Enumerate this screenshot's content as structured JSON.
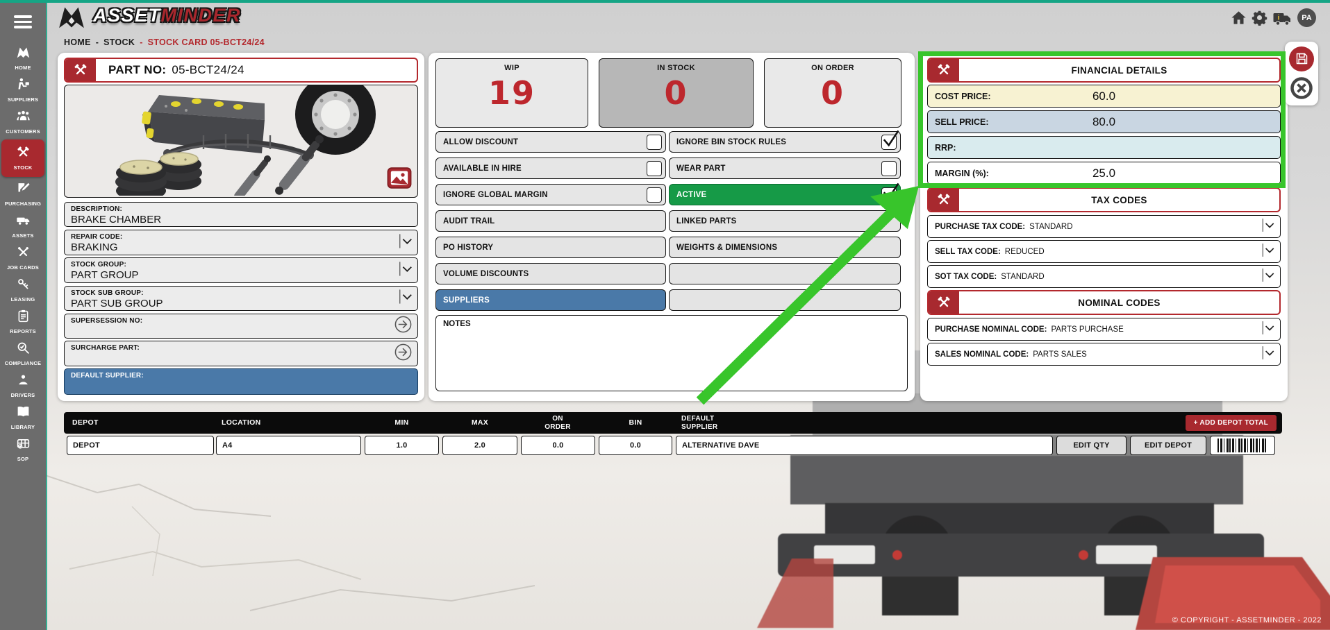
{
  "page": {
    "copyright": "© COPYRIGHT - ASSETMINDER - 2022"
  },
  "topbar": {
    "logo": {
      "mark_icon": "assetminder-mark",
      "asset": "ASSET",
      "minder": "MINDER"
    },
    "actions": {
      "home_icon": "home",
      "settings_icon": "gear",
      "fleet_icon": "truck-info",
      "avatar": "PA"
    }
  },
  "breadcrumb": {
    "home": "HOME",
    "sep1": "-",
    "stock": "STOCK",
    "sep2": "-",
    "current": "STOCK CARD 05-BCT24/24"
  },
  "sidebar": {
    "items": [
      {
        "label": "HOME",
        "icon": "brand-mark"
      },
      {
        "label": "SUPPLIERS",
        "icon": "supplier-person"
      },
      {
        "label": "CUSTOMERS",
        "icon": "people-group"
      },
      {
        "label": "STOCK",
        "icon": "crossed-pistons",
        "active": true
      },
      {
        "label": "PURCHASING",
        "icon": "document-pen"
      },
      {
        "label": "ASSETS",
        "icon": "truck"
      },
      {
        "label": "JOB CARDS",
        "icon": "crossed-tools"
      },
      {
        "label": "LEASING",
        "icon": "keys"
      },
      {
        "label": "REPORTS",
        "icon": "clipboard"
      },
      {
        "label": "COMPLIANCE",
        "icon": "magnifier-check"
      },
      {
        "label": "DRIVERS",
        "icon": "driver"
      },
      {
        "label": "LIBRARY",
        "icon": "open-book"
      },
      {
        "label": "SOP",
        "icon": "van-check"
      }
    ]
  },
  "part_card": {
    "header": {
      "label": "PART NO:",
      "value": "05-BCT24/24",
      "icon": "crossed-pistons"
    },
    "image_icon": "picture",
    "fields": [
      {
        "label": "DESCRIPTION:",
        "value": "BRAKE CHAMBER",
        "control": "none"
      },
      {
        "label": "REPAIR CODE:",
        "value": "BRAKING",
        "control": "dropdown"
      },
      {
        "label": "STOCK GROUP:",
        "value": "PART GROUP",
        "control": "dropdown"
      },
      {
        "label": "STOCK SUB GROUP:",
        "value": "PART SUB GROUP",
        "control": "dropdown"
      },
      {
        "label": "SUPERSESSION NO:",
        "value": "",
        "control": "link-arrow"
      },
      {
        "label": "SURCHARGE PART:",
        "value": "",
        "control": "link-arrow"
      },
      {
        "label": "DEFAULT SUPPLIER:",
        "value": "",
        "control": "none"
      }
    ]
  },
  "counters": [
    {
      "label": "WIP",
      "value": "19"
    },
    {
      "label": "IN STOCK",
      "value": "0"
    },
    {
      "label": "ON ORDER",
      "value": "0"
    }
  ],
  "toggles": [
    {
      "label": "ALLOW DISCOUNT",
      "checked": false
    },
    {
      "label": "IGNORE BIN STOCK RULES",
      "checked": true
    },
    {
      "label": "AVAILABLE IN HIRE",
      "checked": false
    },
    {
      "label": "WEAR PART",
      "checked": false
    },
    {
      "label": "IGNORE GLOBAL MARGIN",
      "checked": false
    },
    {
      "label": "ACTIVE",
      "checked": true
    }
  ],
  "buttons": {
    "audit_trail": "AUDIT TRAIL",
    "linked_parts": "LINKED PARTS",
    "po_history": "PO HISTORY",
    "weights_dimensions": "WEIGHTS & DIMENSIONS",
    "volume_discounts": "VOLUME DISCOUNTS",
    "suppliers": "SUPPLIERS"
  },
  "notes": {
    "label": "NOTES",
    "value": ""
  },
  "financial": {
    "title": "FINANCIAL DETAILS",
    "rows": [
      {
        "label": "COST PRICE:",
        "value": "60.0"
      },
      {
        "label": "SELL PRICE:",
        "value": "80.0"
      },
      {
        "label": "RRP:",
        "value": ""
      },
      {
        "label": "MARGIN (%):",
        "value": "25.0"
      }
    ]
  },
  "tax": {
    "title": "TAX CODES",
    "rows": [
      {
        "label": "PURCHASE TAX CODE:",
        "value": "STANDARD"
      },
      {
        "label": "SELL TAX CODE:",
        "value": "REDUCED"
      },
      {
        "label": "SOT TAX CODE:",
        "value": "STANDARD"
      }
    ]
  },
  "nominal": {
    "title": "NOMINAL CODES",
    "rows": [
      {
        "label": "PURCHASE NOMINAL CODE:",
        "value": "PARTS PURCHASE"
      },
      {
        "label": "SALES NOMINAL CODE:",
        "value": "PARTS SALES"
      }
    ]
  },
  "side_actions": {
    "save_icon": "floppy-disk",
    "close_icon": "close-circle"
  },
  "depot_table": {
    "headers": {
      "depot": "DEPOT",
      "location": "LOCATION",
      "min": "MIN",
      "max": "MAX",
      "on_order": "ON ORDER",
      "bin": "BIN",
      "default_supplier": "DEFAULT SUPPLIER"
    },
    "add_button": "+ ADD DEPOT TOTAL",
    "row": {
      "depot": "DEPOT",
      "location": "A4",
      "min": "1.0",
      "max": "2.0",
      "on_order": "0.0",
      "bin": "0.0",
      "default_supplier": "ALTERNATIVE DAVE",
      "edit_qty": "EDIT QTY",
      "edit_depot": "EDIT DEPOT",
      "barcode_icon": "barcode"
    }
  },
  "colors": {
    "brand_red": "#a8292f",
    "accent_blue": "#4a79a8",
    "active_green": "#169a47",
    "annotation_green": "#38c52b",
    "teal_line": "#15a585",
    "cost_row_bg": "#f7f2d2",
    "sell_row_bg": "#c9d6e2",
    "rrp_row_bg": "#d9ebee",
    "counter_value_red": "#bd272d"
  }
}
